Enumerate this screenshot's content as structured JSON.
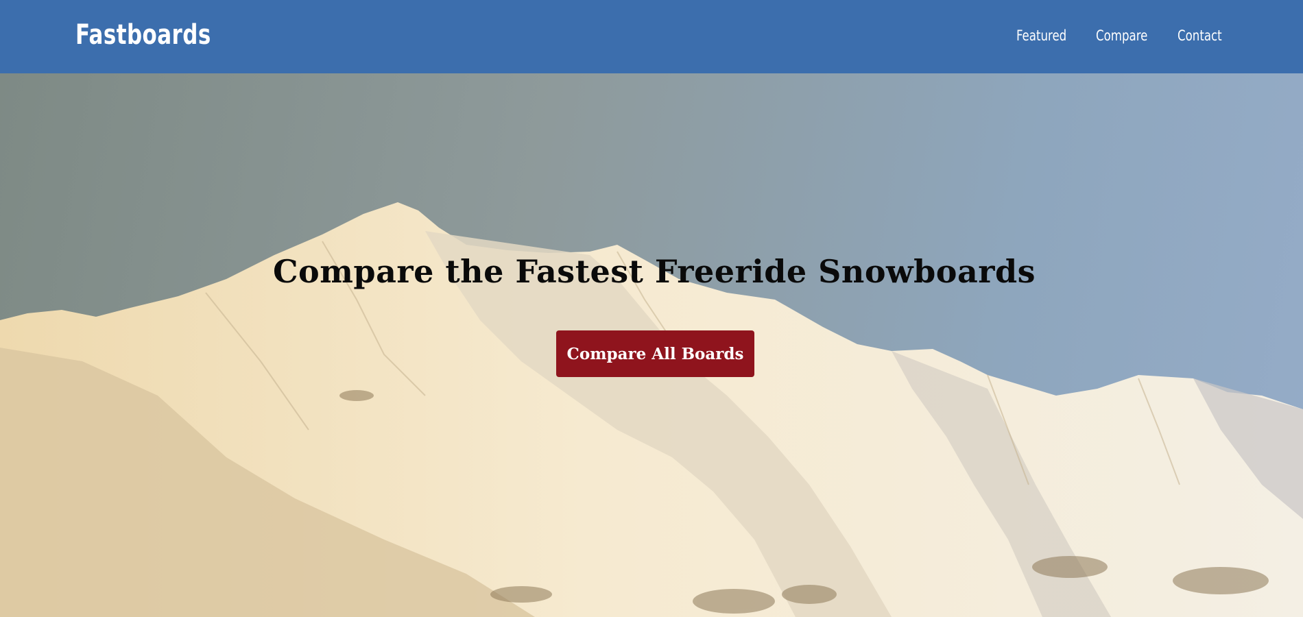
{
  "navbar": {
    "brand": "Fastboards",
    "links": [
      {
        "label": "Featured"
      },
      {
        "label": "Compare"
      },
      {
        "label": "Contact"
      }
    ]
  },
  "hero": {
    "title": "Compare the Fastest Freeride Snowboards",
    "cta_label": "Compare All Boards",
    "background_image": "snowy-mountain-range-photo"
  },
  "colors": {
    "navbar_bg": "#3c6ead",
    "cta_bg": "#8f141d",
    "sky": "#8ea6bd",
    "snow": "#f3e6c9"
  }
}
